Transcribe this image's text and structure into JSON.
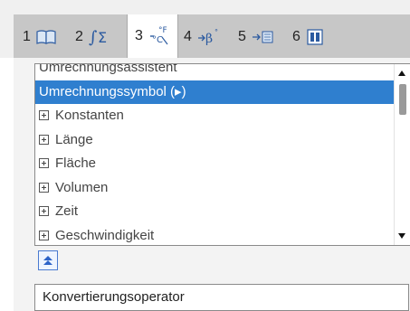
{
  "tabs": [
    {
      "number": "1",
      "icon": "book-icon"
    },
    {
      "number": "2",
      "icon": "integral-sum-icon"
    },
    {
      "number": "3",
      "icon": "unit-conversion-icon",
      "active": true
    },
    {
      "number": "4",
      "icon": "greek-angle-icon"
    },
    {
      "number": "5",
      "icon": "arrow-matrix-icon"
    },
    {
      "number": "6",
      "icon": "library-icon"
    }
  ],
  "list": {
    "items": [
      {
        "label": "Umrechnungsassistent"
      },
      {
        "label": "Umrechnungssymbol (▸)"
      },
      {
        "label": "Konstanten"
      },
      {
        "label": "Länge"
      },
      {
        "label": "Fläche"
      },
      {
        "label": "Volumen"
      },
      {
        "label": "Zeit"
      },
      {
        "label": "Geschwindigkeit"
      }
    ]
  },
  "result": {
    "text": "Konvertierungsoperator"
  },
  "colors": {
    "selection": "#2f7fcf",
    "button_border": "#4a7ad0",
    "tabbar": "#c7c7c7"
  }
}
